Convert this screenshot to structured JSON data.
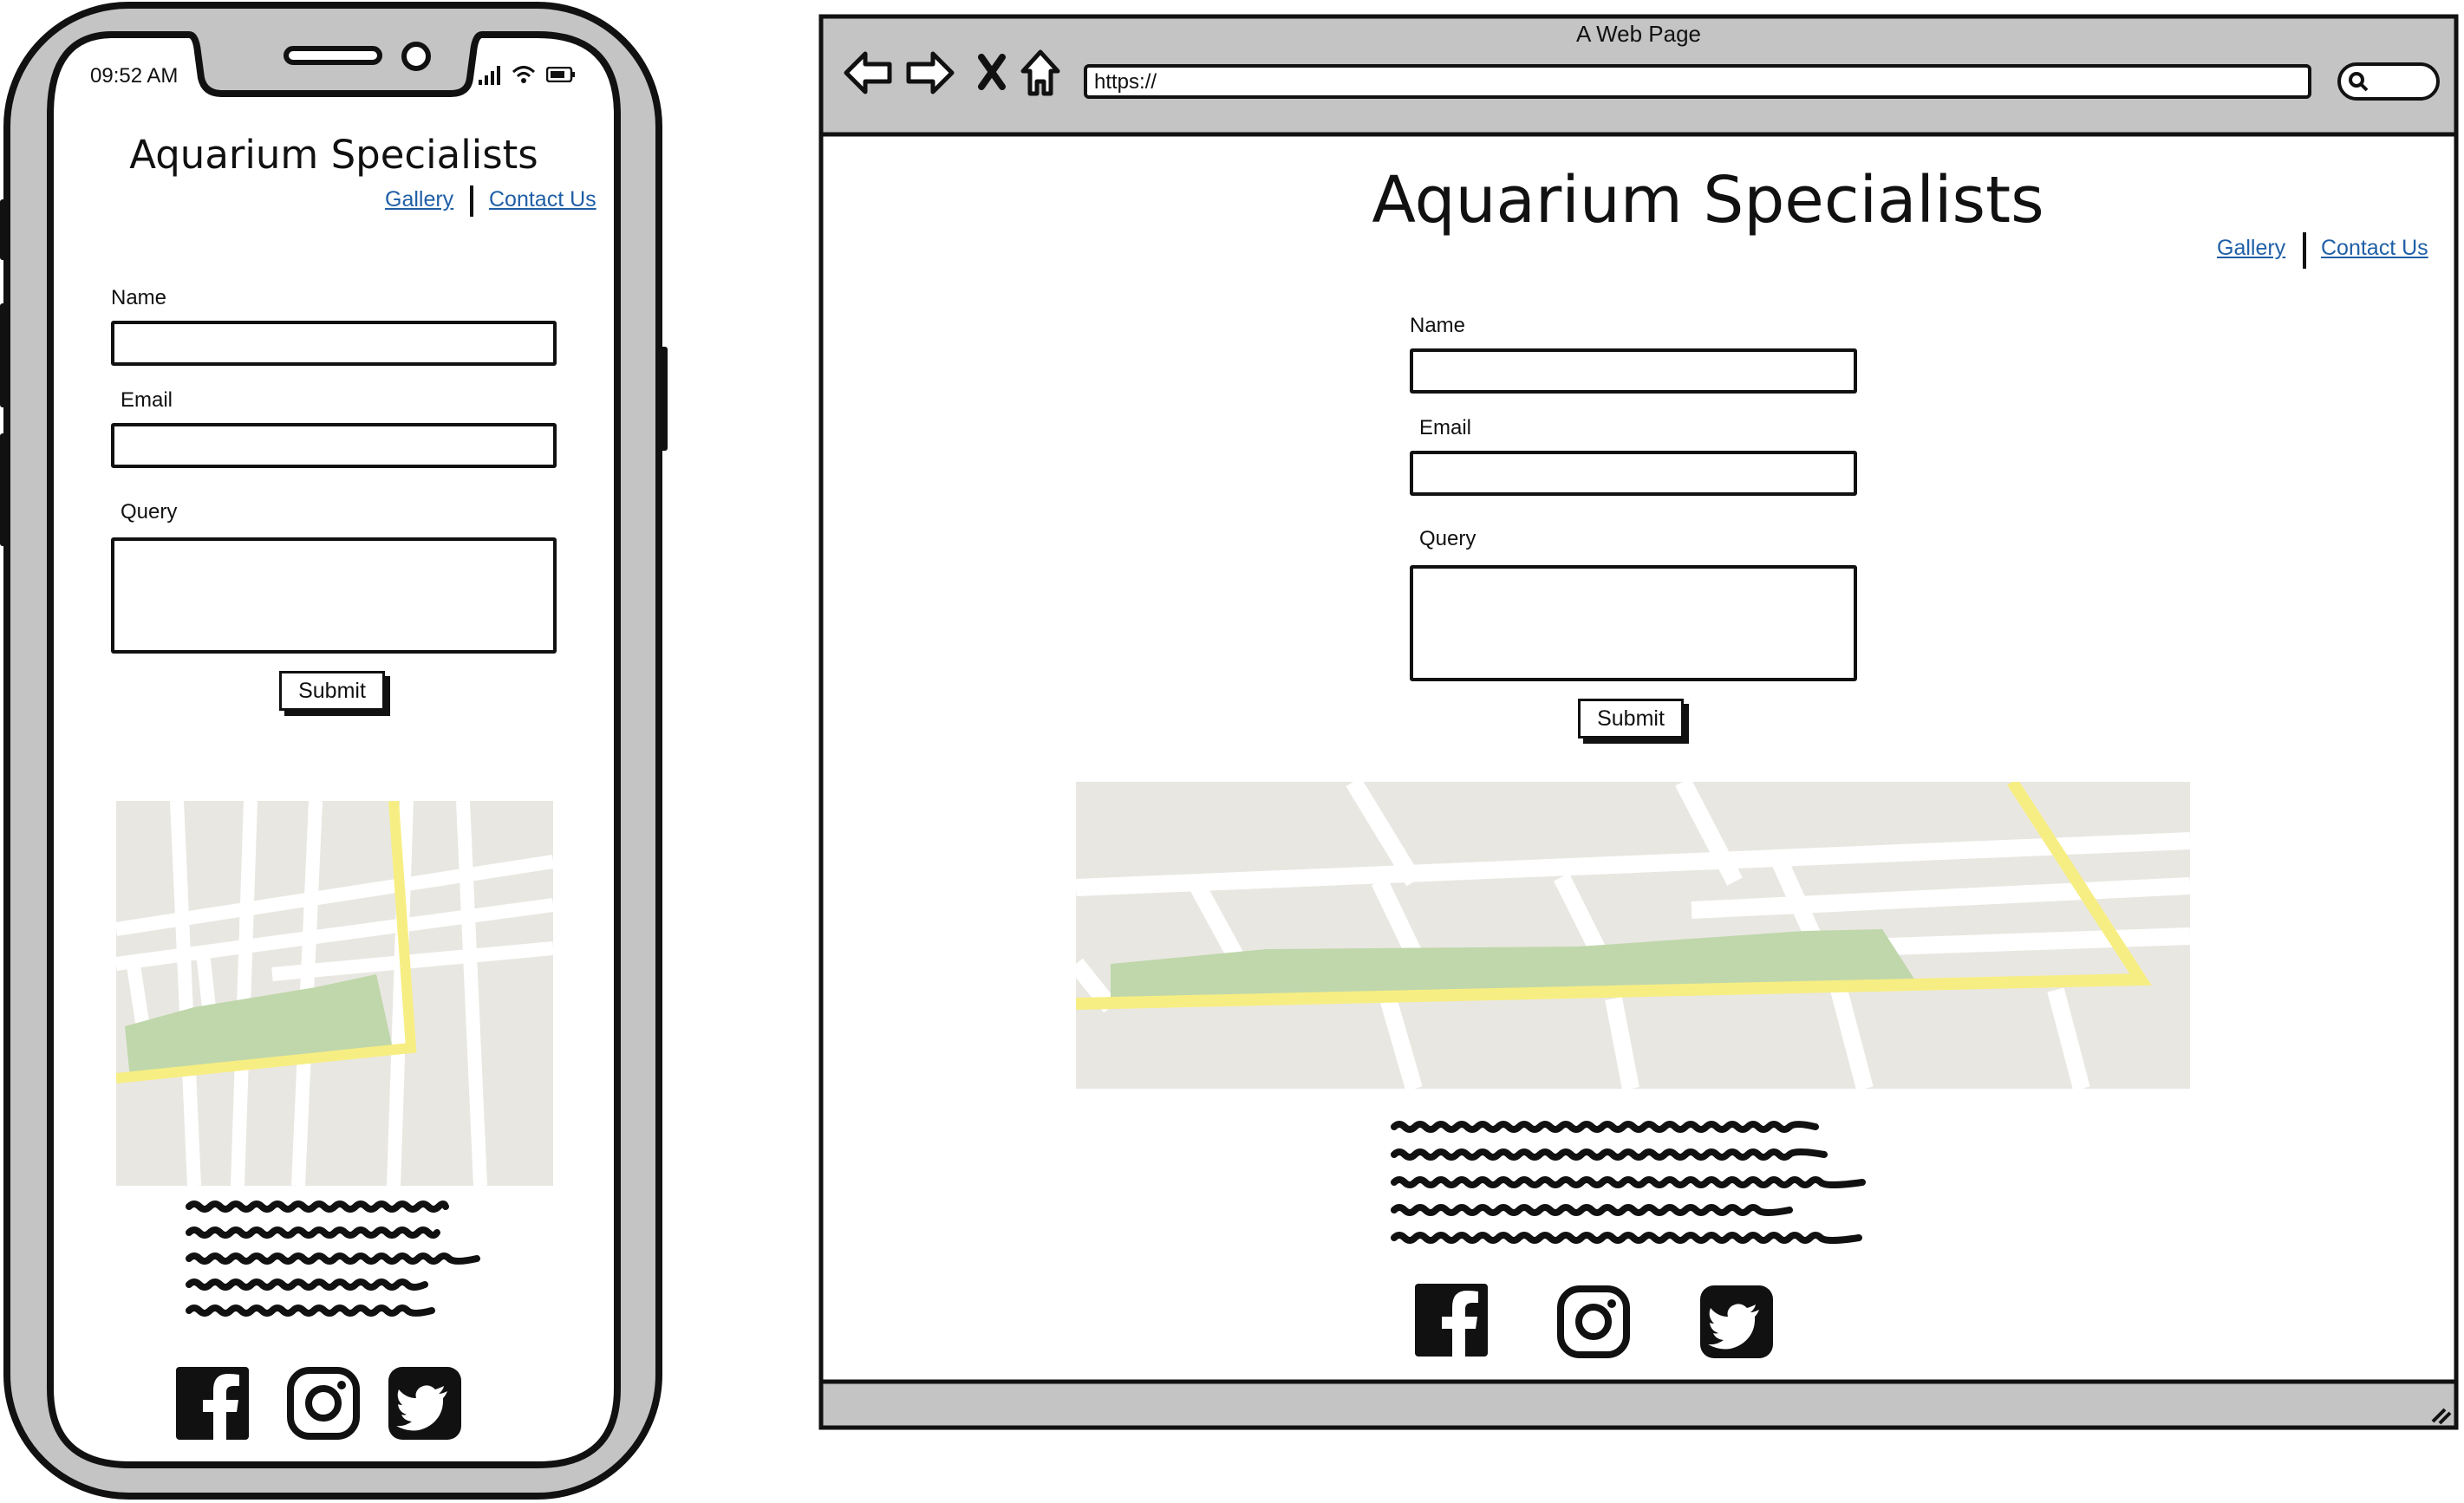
{
  "phone": {
    "status_time": "09:52 AM",
    "site_title": "Aquarium Specialists",
    "nav": [
      {
        "label": "Gallery"
      },
      {
        "label": "Contact Us"
      }
    ],
    "form": {
      "name_label": "Name",
      "email_label": "Email",
      "query_label": "Query",
      "submit_label": "Submit"
    },
    "social": [
      "facebook-icon",
      "instagram-icon",
      "twitter-icon"
    ]
  },
  "browser": {
    "window_title": "A Web Page",
    "url": "https://",
    "site_title": "Aquarium Specialists",
    "nav": [
      {
        "label": "Gallery"
      },
      {
        "label": "Contact Us"
      }
    ],
    "form": {
      "name_label": "Name",
      "email_label": "Email",
      "query_label": "Query",
      "submit_label": "Submit"
    },
    "social": [
      "facebook-icon",
      "instagram-icon",
      "twitter-icon"
    ]
  },
  "colors": {
    "link": "#1f5fa6",
    "frame_gray": "#c4c4c4",
    "map_bg": "#e9e7e1",
    "map_road_major": "#f7ee83",
    "map_park": "#bfd7ab"
  }
}
